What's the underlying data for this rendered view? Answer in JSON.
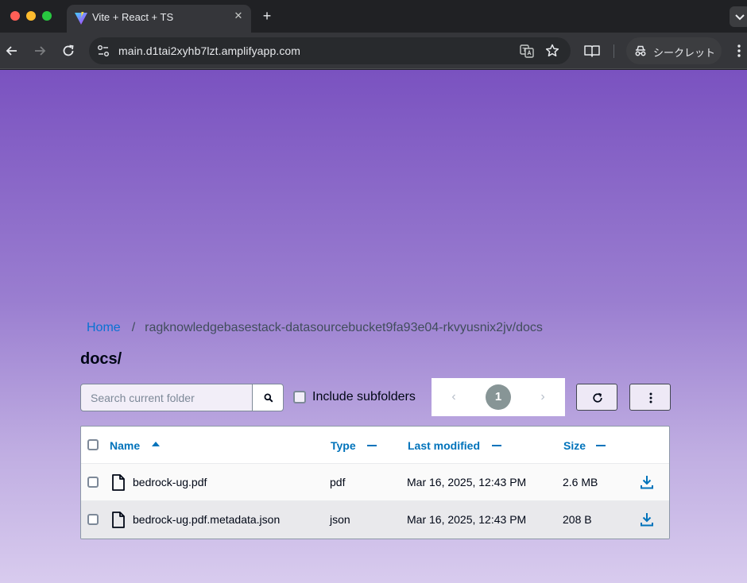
{
  "browser": {
    "tab_title": "Vite + React + TS",
    "url": "main.d1tai2xyhb7lzt.amplifyapp.com",
    "incognito_label": "シークレット"
  },
  "page": {
    "breadcrumb": {
      "home": "Home",
      "separator": "/",
      "current": "ragknowledgebasestack-datasourcebucket9fa93e04-rkvyusnix2jv/docs"
    },
    "folder_title": "docs/",
    "search": {
      "placeholder": "Search current folder",
      "value": ""
    },
    "include_subfolders": {
      "label": "Include subfolders",
      "checked": false
    },
    "pagination": {
      "prev": "‹",
      "current": "1",
      "next": "›"
    },
    "table": {
      "columns": {
        "name": "Name",
        "type": "Type",
        "modified": "Last modified",
        "size": "Size"
      },
      "rows": [
        {
          "name": "bedrock-ug.pdf",
          "type": "pdf",
          "modified": "Mar 16, 2025, 12:43 PM",
          "size": "2.6 MB"
        },
        {
          "name": "bedrock-ug.pdf.metadata.json",
          "type": "json",
          "modified": "Mar 16, 2025, 12:43 PM",
          "size": "208 B"
        }
      ]
    }
  },
  "colors": {
    "link": "#0972d3",
    "header_link": "#0073bb",
    "gradient_top": "#7a52c0",
    "gradient_bottom": "#d8cbee",
    "chrome_dark": "#202124"
  },
  "icons": {
    "tab": "vite-logo-icon",
    "search": "magnifier-icon",
    "refresh": "refresh-icon",
    "actions": "vertical-dots-icon",
    "file": "file-icon",
    "download": "download-icon"
  }
}
